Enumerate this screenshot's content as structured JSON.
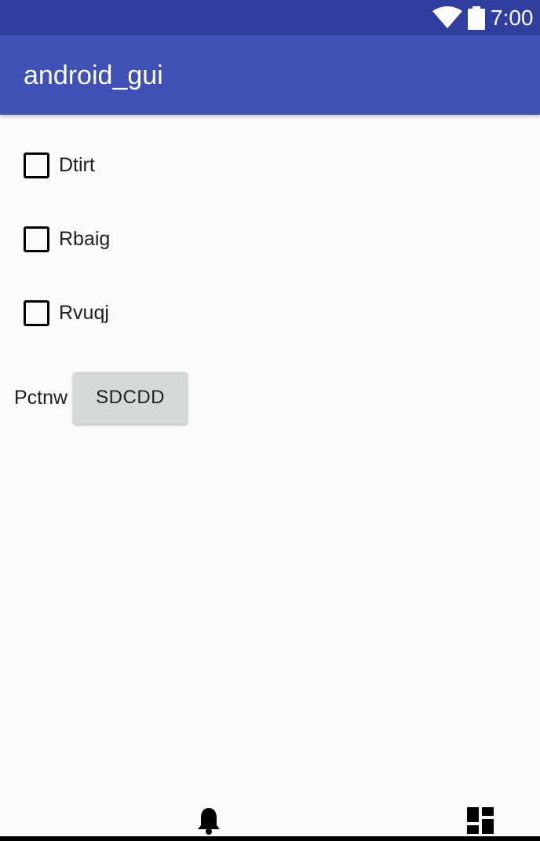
{
  "status_bar": {
    "time": "7:00",
    "wifi_icon": "wifi-icon",
    "battery_icon": "battery-icon",
    "color": "#303f9f"
  },
  "app_bar": {
    "title": "android_gui",
    "color": "#3f51b5"
  },
  "checkboxes": [
    {
      "label": "Dtirt",
      "checked": false
    },
    {
      "label": "Rbaig",
      "checked": false
    },
    {
      "label": "Rvuqj",
      "checked": false
    }
  ],
  "action_row": {
    "label": "Pctnw",
    "button_label": "SDCDD"
  },
  "bottom_icons": [
    "bell-icon",
    "dashboard-icon"
  ]
}
